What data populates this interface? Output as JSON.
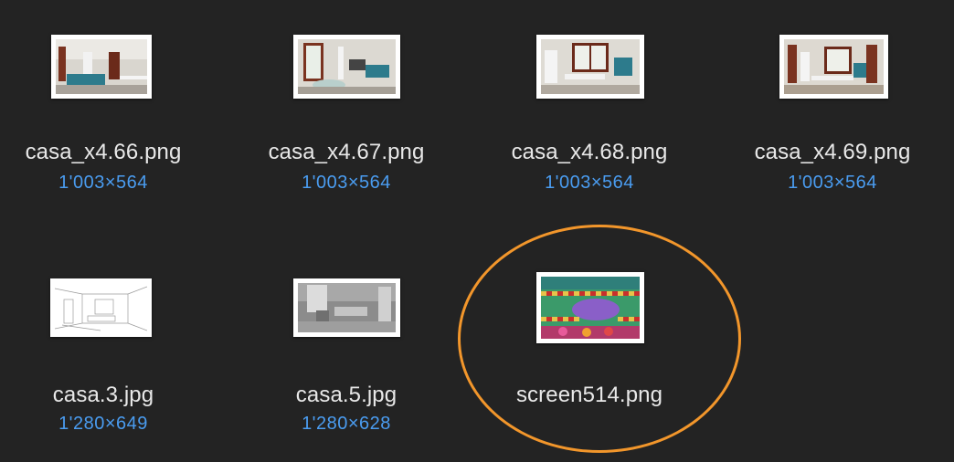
{
  "files": [
    {
      "name": "casa_x4.66.png",
      "dimensions": "1'003×564",
      "thumb_icon": "room-render-thumbnail"
    },
    {
      "name": "casa_x4.67.png",
      "dimensions": "1'003×564",
      "thumb_icon": "room-render-thumbnail"
    },
    {
      "name": "casa_x4.68.png",
      "dimensions": "1'003×564",
      "thumb_icon": "room-render-thumbnail"
    },
    {
      "name": "casa_x4.69.png",
      "dimensions": "1'003×564",
      "thumb_icon": "room-render-thumbnail"
    },
    {
      "name": "casa.3.jpg",
      "dimensions": "1'280×649",
      "thumb_icon": "line-drawing-thumbnail"
    },
    {
      "name": "casa.5.jpg",
      "dimensions": "1'280×628",
      "thumb_icon": "grayscale-render-thumbnail"
    },
    {
      "name": "screen514.png",
      "dimensions": "",
      "thumb_icon": "game-screenshot-thumbnail"
    }
  ],
  "annotation": {
    "color": "#f2962b",
    "shape": "ellipse-highlight"
  },
  "colors": {
    "background": "#232323",
    "filename": "#e8e8e8",
    "dimensions": "#4a9cf0"
  }
}
